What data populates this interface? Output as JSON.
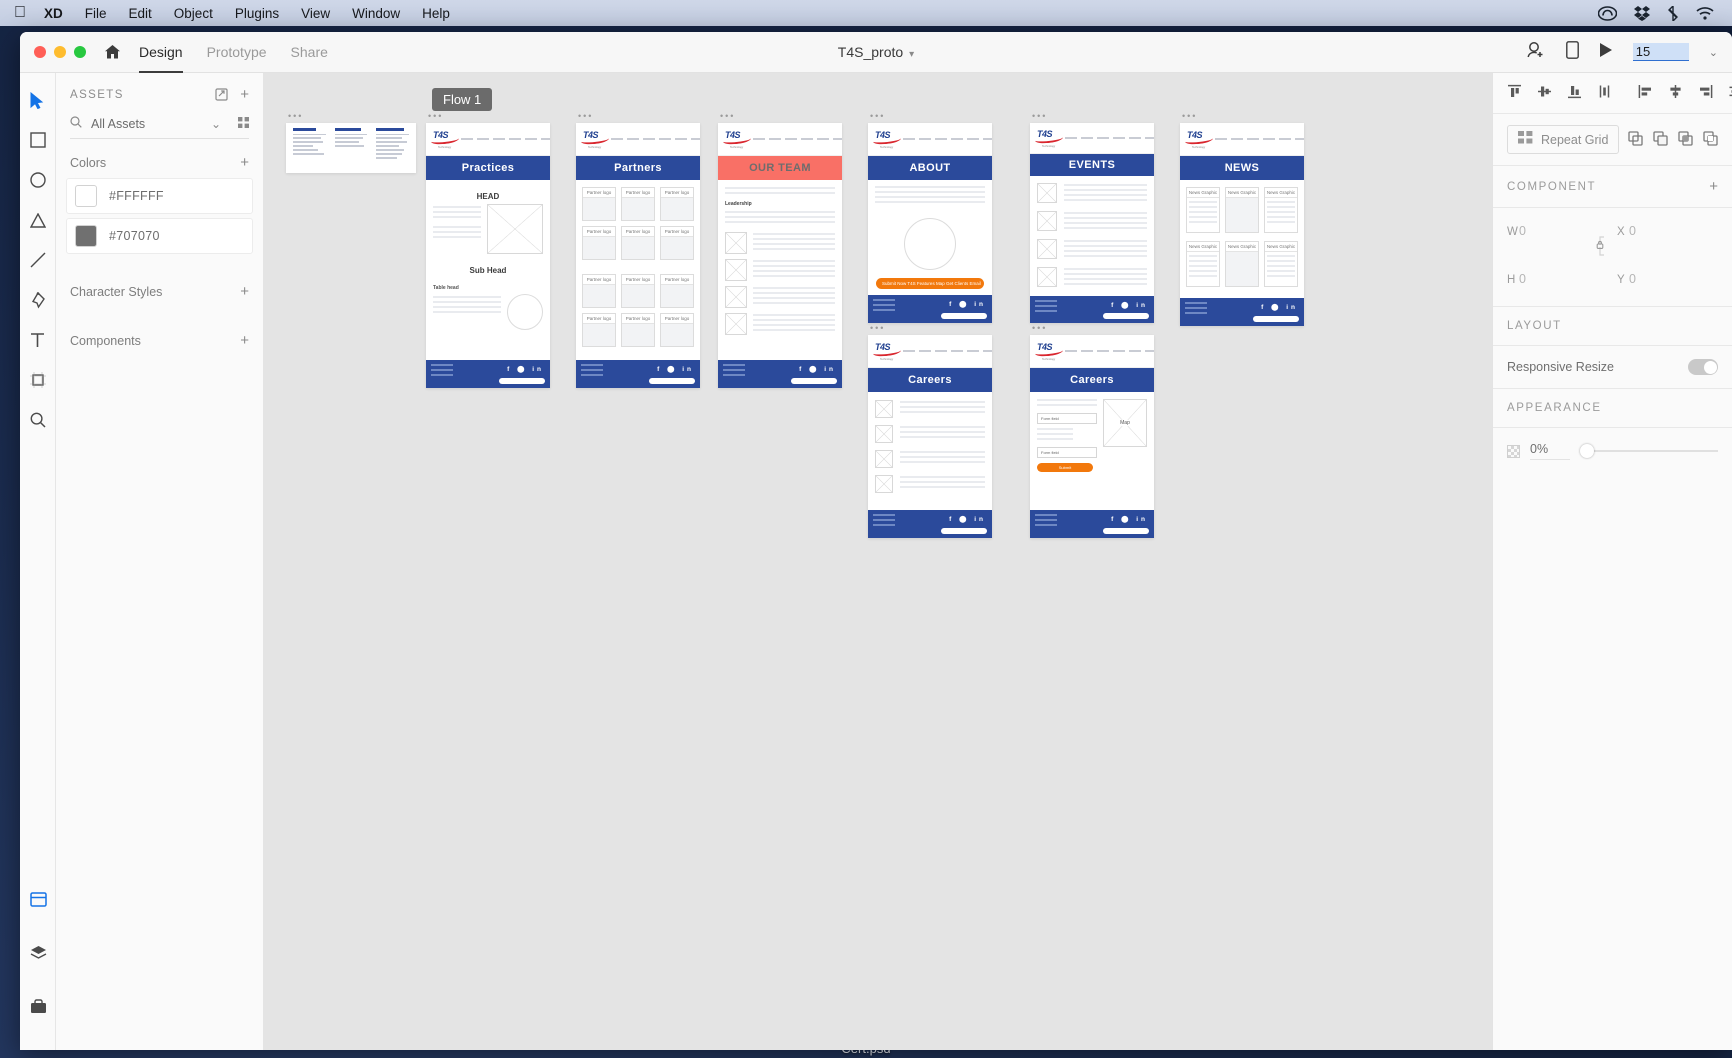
{
  "os_menu": {
    "apple": "apple-logo",
    "items": [
      "XD",
      "File",
      "Edit",
      "Object",
      "Plugins",
      "View",
      "Window",
      "Help"
    ],
    "tray_icons": [
      "creative-cloud-icon",
      "dropbox-icon",
      "bluetooth-icon",
      "wifi-icon"
    ]
  },
  "desktop": {
    "file_label": "Cert.psd"
  },
  "titlebar": {
    "home_icon": "home-icon",
    "tabs": [
      {
        "label": "Design",
        "active": true
      },
      {
        "label": "Prototype",
        "active": false
      },
      {
        "label": "Share",
        "active": false
      }
    ],
    "document_title": "T4S_proto",
    "title_chevron": "▾",
    "invite_icon": "invite-user-icon",
    "device_icon": "device-preview-icon",
    "play_icon": "desktop-preview-icon",
    "zoom_value": "15",
    "zoom_chevron": "⌄"
  },
  "toolbar": {
    "tools": [
      "select-tool",
      "rectangle-tool",
      "ellipse-tool",
      "polygon-tool",
      "line-tool",
      "pen-tool",
      "text-tool",
      "artboard-tool",
      "zoom-tool"
    ],
    "bottom_tools": [
      "assets-panel-toggle",
      "layers-panel-toggle",
      "plugins-panel-toggle"
    ]
  },
  "assets_panel": {
    "title": "ASSETS",
    "link_icon": "link-document-icon",
    "add_icon": "+",
    "search": {
      "icon": "search-icon",
      "value": "All Assets",
      "chevron": "⌄",
      "grid_icon": "grid-view-icon"
    },
    "sections": [
      {
        "label": "Colors",
        "add": "+",
        "swatches": [
          {
            "hex": "#FFFFFF",
            "label": "#FFFFFF"
          },
          {
            "hex": "#707070",
            "label": "#707070"
          }
        ]
      },
      {
        "label": "Character Styles",
        "add": "+",
        "swatches": []
      },
      {
        "label": "Components",
        "add": "+",
        "swatches": []
      }
    ]
  },
  "canvas": {
    "flow_label": "Flow 1",
    "artboard_dots": "•••",
    "logo_text": "T4S",
    "logo_sub": "Technology",
    "artboards": [
      {
        "name": "sitemap",
        "title": "",
        "type": "sitemap"
      },
      {
        "name": "practices",
        "title": "Practices",
        "banner_color": "#2b4a9b",
        "labels": [
          "HEAD",
          "Sub Head",
          "Table head"
        ]
      },
      {
        "name": "partners",
        "title": "Partners",
        "banner_color": "#2b4a9b",
        "card_label": "Partner logo",
        "card_rows": 4,
        "card_cols": 3
      },
      {
        "name": "our-team",
        "title": "OUR TEAM",
        "banner_color": "#f97066",
        "labels": [
          "Leadership"
        ]
      },
      {
        "name": "about",
        "title": "ABOUT",
        "banner_color": "#2b4a9b",
        "cta": "Submit Now T4S Features Map Get Clients Email"
      },
      {
        "name": "events",
        "title": "EVENTS",
        "banner_color": "#2b4a9b"
      },
      {
        "name": "news",
        "title": "NEWS",
        "banner_color": "#2b4a9b",
        "card_label": "News Graphic",
        "card_rows": 2,
        "card_cols": 3
      },
      {
        "name": "careers-list",
        "title": "Careers",
        "banner_color": "#2b4a9b"
      },
      {
        "name": "careers-form",
        "title": "Careers",
        "banner_color": "#2b4a9b",
        "labels": [
          "Form field",
          "Form field",
          "Map"
        ],
        "cta": "Submit"
      }
    ],
    "footer_social": "f  ⬤  in"
  },
  "properties": {
    "align_icons": [
      "align-top",
      "align-vertical-center",
      "align-bottom",
      "distribute-vertical",
      "align-left",
      "align-horizontal-center",
      "align-right",
      "distribute-horizontal"
    ],
    "repeat_grid": {
      "icon": "repeat-grid-icon",
      "label": "Repeat Grid"
    },
    "boolean_icons": [
      "boolean-add-icon",
      "boolean-subtract-icon",
      "boolean-intersect-icon",
      "boolean-exclude-icon"
    ],
    "component_section": {
      "label": "COMPONENT",
      "add": "+"
    },
    "transform": {
      "w_label": "W",
      "w_value": "0",
      "h_label": "H",
      "h_value": "0",
      "x_label": "X",
      "x_value": "0",
      "y_label": "Y",
      "y_value": "0",
      "lock_icon": "lock-aspect-ratio-icon"
    },
    "layout_section": {
      "label": "LAYOUT",
      "responsive_label": "Responsive Resize",
      "toggle_on": false
    },
    "appearance_section": {
      "label": "APPEARANCE",
      "opacity_value": "0%",
      "opacity_icon": "opacity-checker-icon"
    }
  }
}
